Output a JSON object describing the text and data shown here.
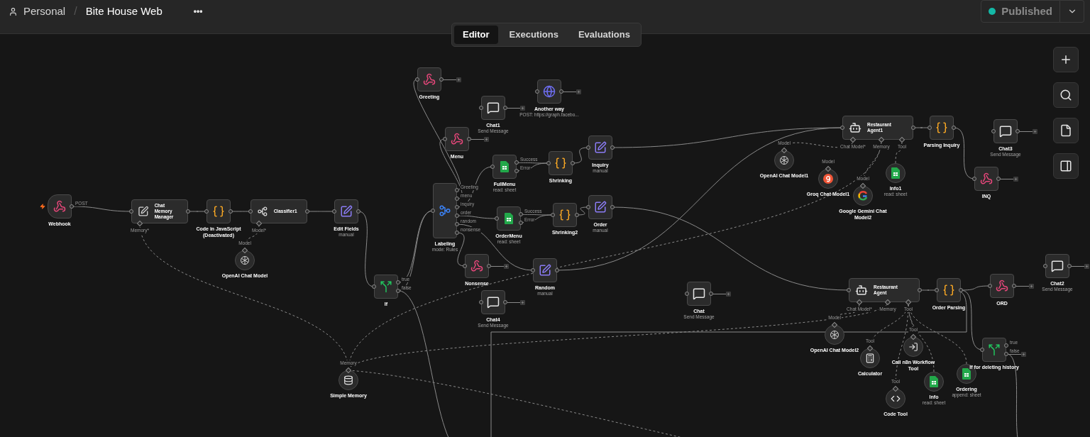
{
  "header": {
    "separator": "/",
    "breadcrumb": [
      {
        "kind": "user",
        "label": "Personal"
      },
      {
        "kind": "plain",
        "label": "Bite House Web"
      }
    ],
    "more_label": "•••",
    "publish": {
      "label": "Published",
      "color": "#14b8a6"
    }
  },
  "tabs": [
    {
      "label": "Editor",
      "selected": true
    },
    {
      "label": "Executions",
      "selected": false
    },
    {
      "label": "Evaluations",
      "selected": false
    }
  ],
  "toolbar": [
    {
      "kind": "add"
    },
    {
      "kind": "search"
    },
    {
      "kind": "note"
    },
    {
      "kind": "panel"
    }
  ],
  "nodes": [
    {
      "kind": "webhook",
      "label": "Webhook",
      "outputs": [
        "POST"
      ]
    },
    {
      "kind": "memory-manager",
      "label": "Chat Memory Manager",
      "bottom_ports": [
        "Memory*"
      ]
    },
    {
      "kind": "code",
      "label": "Code in JavaScript (Deactivated)"
    },
    {
      "kind": "classifier",
      "label": "Classifier1",
      "bottom_ports": [
        "Model*"
      ]
    },
    {
      "kind": "openai",
      "label": "OpenAI Chat Model",
      "top_port": "Model"
    },
    {
      "kind": "set",
      "label": "Edit Fields",
      "subtitle": "manual"
    },
    {
      "kind": "if",
      "label": "If",
      "outputs": [
        "true",
        "false"
      ]
    },
    {
      "kind": "switch",
      "label": "Labeling",
      "subtitle": "mode: Rules",
      "outputs": [
        "Greeting",
        "menu",
        "inquiry",
        "order",
        "random",
        "nonsense"
      ]
    },
    {
      "kind": "respond",
      "label": "Greeting",
      "open_end": true
    },
    {
      "kind": "chat",
      "label": "Chat1",
      "subtitle": "Send Message",
      "open_end": true
    },
    {
      "kind": "http",
      "label": "Another way",
      "subtitle": "POST: https://graph.facebo...",
      "open_end": true
    },
    {
      "kind": "respond",
      "label": "Menu",
      "open_end": true
    },
    {
      "kind": "sheets",
      "label": "FullMenu",
      "subtitle": "read: sheet",
      "outputs": [
        "Success",
        "Error"
      ]
    },
    {
      "kind": "code",
      "label": "Shrinking"
    },
    {
      "kind": "set",
      "label": "Inquiry",
      "subtitle": "manual"
    },
    {
      "kind": "sheets",
      "label": "OrderMenu",
      "subtitle": "read: sheet",
      "outputs": [
        "Success",
        "Error"
      ]
    },
    {
      "kind": "code",
      "label": "Shrinking2"
    },
    {
      "kind": "set",
      "label": "Order",
      "subtitle": "manual"
    },
    {
      "kind": "respond",
      "label": "Nonsense",
      "open_end": true
    },
    {
      "kind": "set",
      "label": "Random",
      "subtitle": "manual"
    },
    {
      "kind": "chat",
      "label": "Chat4",
      "subtitle": "Send Message",
      "open_end": true
    },
    {
      "kind": "chat",
      "label": "Chat",
      "subtitle": "Send Message",
      "open_end": true
    },
    {
      "kind": "agent",
      "label": "Restaurant Agent1",
      "bottom_ports": [
        "Chat Model*",
        "Memory",
        "Tool"
      ]
    },
    {
      "kind": "openai",
      "label": "OpenAI Chat Model1",
      "top_port": "Model"
    },
    {
      "kind": "groq",
      "label": "Groq Chat Model1",
      "top_port": "Model"
    },
    {
      "kind": "gemini",
      "label": "Google Gemini Chat Model2",
      "top_port": "Model"
    },
    {
      "kind": "sheets-tool",
      "label": "Info1",
      "subtitle": "read: sheet"
    },
    {
      "kind": "code",
      "label": "Parsing Inquiry"
    },
    {
      "kind": "chat",
      "label": "Chat3",
      "subtitle": "Send Message",
      "open_end": true
    },
    {
      "kind": "respond",
      "label": "INQ",
      "open_end": true
    },
    {
      "kind": "agent",
      "label": "Restaurant Agent",
      "bottom_ports": [
        "Chat Model*",
        "Memory",
        "Tool"
      ]
    },
    {
      "kind": "code",
      "label": "Order Parsing"
    },
    {
      "kind": "respond",
      "label": "ORD",
      "open_end": true
    },
    {
      "kind": "chat",
      "label": "Chat2",
      "subtitle": "Send Message",
      "open_end": true
    },
    {
      "kind": "openai",
      "label": "OpenAI Chat Model2",
      "top_port": "Model"
    },
    {
      "kind": "calculator",
      "label": "Calculator",
      "top_port": "Tool"
    },
    {
      "kind": "workflow",
      "label": "Call n8n Workflow Tool",
      "top_port": "Tool"
    },
    {
      "kind": "code-tool",
      "label": "Code Tool",
      "top_port": "Tool"
    },
    {
      "kind": "sheets-tool",
      "label": "Info",
      "subtitle": "read: sheet"
    },
    {
      "kind": "sheets-tool",
      "label": "Ordering",
      "subtitle": "append: sheet"
    },
    {
      "kind": "if",
      "label": "If for deleting history",
      "outputs": [
        "true",
        "false"
      ],
      "open_end": true
    },
    {
      "kind": "memory",
      "label": "Simple Memory",
      "top_port": "Memory"
    }
  ]
}
